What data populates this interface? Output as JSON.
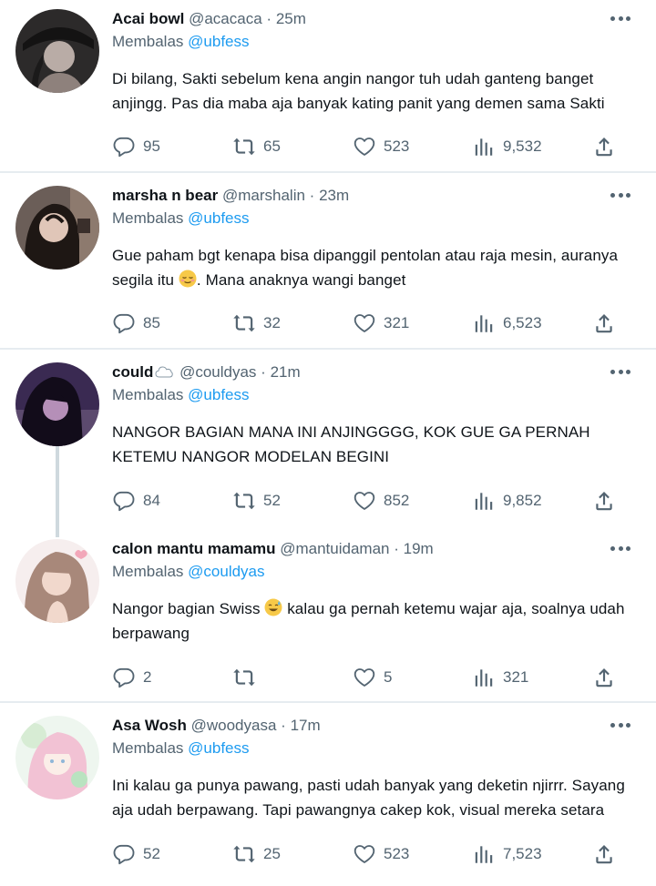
{
  "tweets": [
    {
      "name": "Acai bowl",
      "handle": "@acacaca",
      "time": "25m",
      "reply_prefix": "Membalas",
      "reply_to": "@ubfess",
      "text": "Di bilang, Sakti sebelum kena angin nangor tuh udah ganteng banget anjingg. Pas dia maba aja banyak kating panit yang demen sama Sakti",
      "replies": "95",
      "retweets": "65",
      "likes": "523",
      "views": "9,532",
      "avatar_color": "#3b3533"
    },
    {
      "name": "marsha n bear",
      "handle": "@marshalin",
      "time": "23m",
      "reply_prefix": "Membalas",
      "reply_to": "@ubfess",
      "text_a": "Gue paham bgt kenapa bisa dipanggil pentolan atau raja mesin, auranya segila itu ",
      "text_b": ". Mana anaknya wangi banget",
      "emoji": "relieved-face-emoji",
      "replies": "85",
      "retweets": "32",
      "likes": "321",
      "views": "6,523",
      "avatar_color": "#5a4a44"
    },
    {
      "name": "could",
      "handle": "@couldyas",
      "time": "21m",
      "name_icon": "cloud-icon",
      "reply_prefix": "Membalas",
      "reply_to": "@ubfess",
      "text": "NANGOR BAGIAN MANA INI ANJINGGGG, KOK GUE GA PERNAH KETEMU NANGOR MODELAN BEGINI",
      "replies": "84",
      "retweets": "52",
      "likes": "852",
      "views": "9,852",
      "avatar_color": "#2b1d3d"
    },
    {
      "name": "calon mantu mamamu",
      "handle": "@mantuidaman",
      "time": "19m",
      "reply_prefix": "Membalas",
      "reply_to": "@couldyas",
      "text_a": "Nangor bagian Swiss ",
      "text_b": " kalau ga pernah ketemu wajar aja, soalnya udah berpawang",
      "emoji": "sweat-smile-emoji",
      "replies": "2",
      "retweets": "",
      "likes": "5",
      "views": "321",
      "avatar_color": "#c9a89a"
    },
    {
      "name": "Asa Wosh",
      "handle": "@woodyasa",
      "time": "17m",
      "reply_prefix": "Membalas",
      "reply_to": "@ubfess",
      "text": "Ini kalau ga punya pawang, pasti udah banyak yang deketin njirrr. Sayang aja udah berpawang. Tapi pawangnya cakep kok, visual mereka setara",
      "replies": "52",
      "retweets": "25",
      "likes": "523",
      "views": "7,523",
      "avatar_color": "#f3dde6"
    }
  ],
  "colors": {
    "link": "#1d9bf0",
    "muted": "#536471",
    "text": "#0f1419",
    "divider": "#e6ecf0"
  },
  "icons": {
    "reply": "comment-icon",
    "retweet": "retweet-icon",
    "like": "heart-icon",
    "views": "views-icon",
    "share": "share-icon",
    "more": "more-icon"
  }
}
